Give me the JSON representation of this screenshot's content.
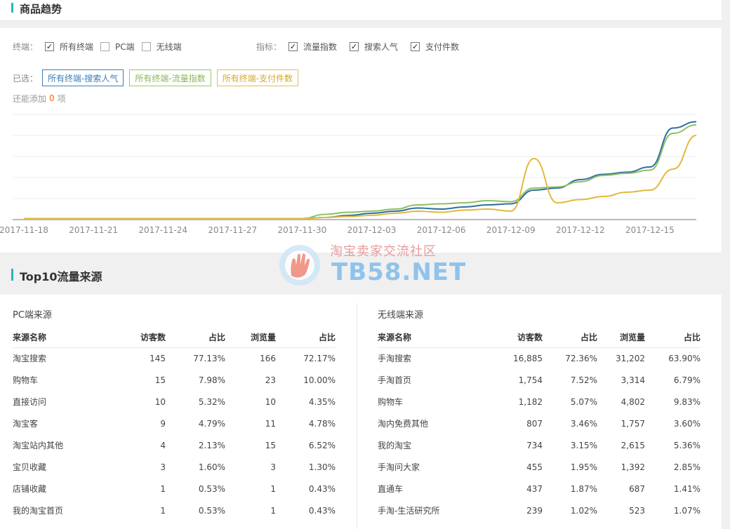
{
  "trend": {
    "title": "商品趋势",
    "terminal_label": "终端：",
    "terminals": [
      {
        "label": "所有终端",
        "checked": true
      },
      {
        "label": "PC端",
        "checked": false
      },
      {
        "label": "无线端",
        "checked": false
      }
    ],
    "metric_label": "指标：",
    "metrics": [
      {
        "label": "流量指数",
        "checked": true
      },
      {
        "label": "搜索人气",
        "checked": true
      },
      {
        "label": "支付件数",
        "checked": true
      }
    ],
    "selected_label": "已选：",
    "selected_tags": [
      "所有终端-搜索人气",
      "所有终端-流量指数",
      "所有终端-支付件数"
    ],
    "add_more_prefix": "还能添加",
    "add_more_count": "0",
    "add_more_suffix": "项",
    "check_glyph": "✓"
  },
  "chart_data": {
    "type": "line",
    "x": [
      "2017-11-18",
      "2017-11-19",
      "2017-11-20",
      "2017-11-21",
      "2017-11-22",
      "2017-11-23",
      "2017-11-24",
      "2017-11-25",
      "2017-11-26",
      "2017-11-27",
      "2017-11-28",
      "2017-11-29",
      "2017-11-30",
      "2017-12-01",
      "2017-12-02",
      "2017-12-03",
      "2017-12-04",
      "2017-12-05",
      "2017-12-06",
      "2017-12-07",
      "2017-12-08",
      "2017-12-09",
      "2017-12-10",
      "2017-12-11",
      "2017-12-12",
      "2017-12-13",
      "2017-12-14",
      "2017-12-15",
      "2017-12-16",
      "2017-12-17"
    ],
    "tick_labels": [
      "2017-11-18",
      "2017-11-21",
      "2017-11-24",
      "2017-11-27",
      "2017-11-30",
      "2017-12-03",
      "2017-12-06",
      "2017-12-09",
      "2017-12-12",
      "2017-12-15"
    ],
    "series": [
      {
        "name": "所有终端-搜索人气",
        "color": "#2e6e9e",
        "values": [
          1,
          1,
          1,
          1,
          1,
          1,
          1,
          1,
          1,
          1,
          1,
          1,
          1,
          2,
          4,
          6,
          8,
          11,
          10,
          12,
          14,
          15,
          28,
          30,
          38,
          43,
          45,
          50,
          87,
          93
        ]
      },
      {
        "name": "所有终端-流量指数",
        "color": "#8cc063",
        "values": [
          1,
          1,
          1,
          1,
          1,
          1,
          1,
          1,
          1,
          1,
          1,
          1,
          1,
          5,
          7,
          8,
          10,
          14,
          15,
          16,
          18,
          17,
          30,
          31,
          36,
          42,
          44,
          47,
          82,
          90
        ]
      },
      {
        "name": "所有终端-支付件数",
        "color": "#e2b93b",
        "values": [
          1,
          1,
          1,
          1,
          1,
          1,
          1,
          1,
          1,
          1,
          1,
          1,
          1,
          2,
          3,
          4,
          6,
          8,
          7,
          9,
          10,
          8,
          58,
          16,
          19,
          22,
          26,
          28,
          48,
          80
        ]
      }
    ],
    "ylim": [
      0,
      100
    ],
    "grid": true
  },
  "sources": {
    "title": "Top10流量来源",
    "pc": {
      "title": "PC端来源",
      "headers": [
        "来源名称",
        "访客数",
        "占比",
        "浏览量",
        "占比"
      ],
      "rows": [
        [
          "淘宝搜索",
          "145",
          "77.13%",
          "166",
          "72.17%"
        ],
        [
          "购物车",
          "15",
          "7.98%",
          "23",
          "10.00%"
        ],
        [
          "直接访问",
          "10",
          "5.32%",
          "10",
          "4.35%"
        ],
        [
          "淘宝客",
          "9",
          "4.79%",
          "11",
          "4.78%"
        ],
        [
          "淘宝站内其他",
          "4",
          "2.13%",
          "15",
          "6.52%"
        ],
        [
          "宝贝收藏",
          "3",
          "1.60%",
          "3",
          "1.30%"
        ],
        [
          "店铺收藏",
          "1",
          "0.53%",
          "1",
          "0.43%"
        ],
        [
          "我的淘宝首页",
          "1",
          "0.53%",
          "1",
          "0.43%"
        ]
      ]
    },
    "mobile": {
      "title": "无线端来源",
      "headers": [
        "来源名称",
        "访客数",
        "占比",
        "浏览量",
        "占比"
      ],
      "rows": [
        [
          "手淘搜索",
          "16,885",
          "72.36%",
          "31,202",
          "63.90%"
        ],
        [
          "手淘首页",
          "1,754",
          "7.52%",
          "3,314",
          "6.79%"
        ],
        [
          "购物车",
          "1,182",
          "5.07%",
          "4,802",
          "9.83%"
        ],
        [
          "淘内免费其他",
          "807",
          "3.46%",
          "1,757",
          "3.60%"
        ],
        [
          "我的淘宝",
          "734",
          "3.15%",
          "2,615",
          "5.36%"
        ],
        [
          "手淘问大家",
          "455",
          "1.95%",
          "1,392",
          "2.85%"
        ],
        [
          "直通车",
          "437",
          "1.87%",
          "687",
          "1.41%"
        ],
        [
          "手淘-生活研究所",
          "239",
          "1.02%",
          "523",
          "1.07%"
        ]
      ]
    }
  },
  "watermark": {
    "text_cn": "淘宝卖家交流社区",
    "text_en": "TB58.NET",
    "colors": {
      "red": "#e89a9a",
      "blue": "#8fc3ec"
    }
  }
}
